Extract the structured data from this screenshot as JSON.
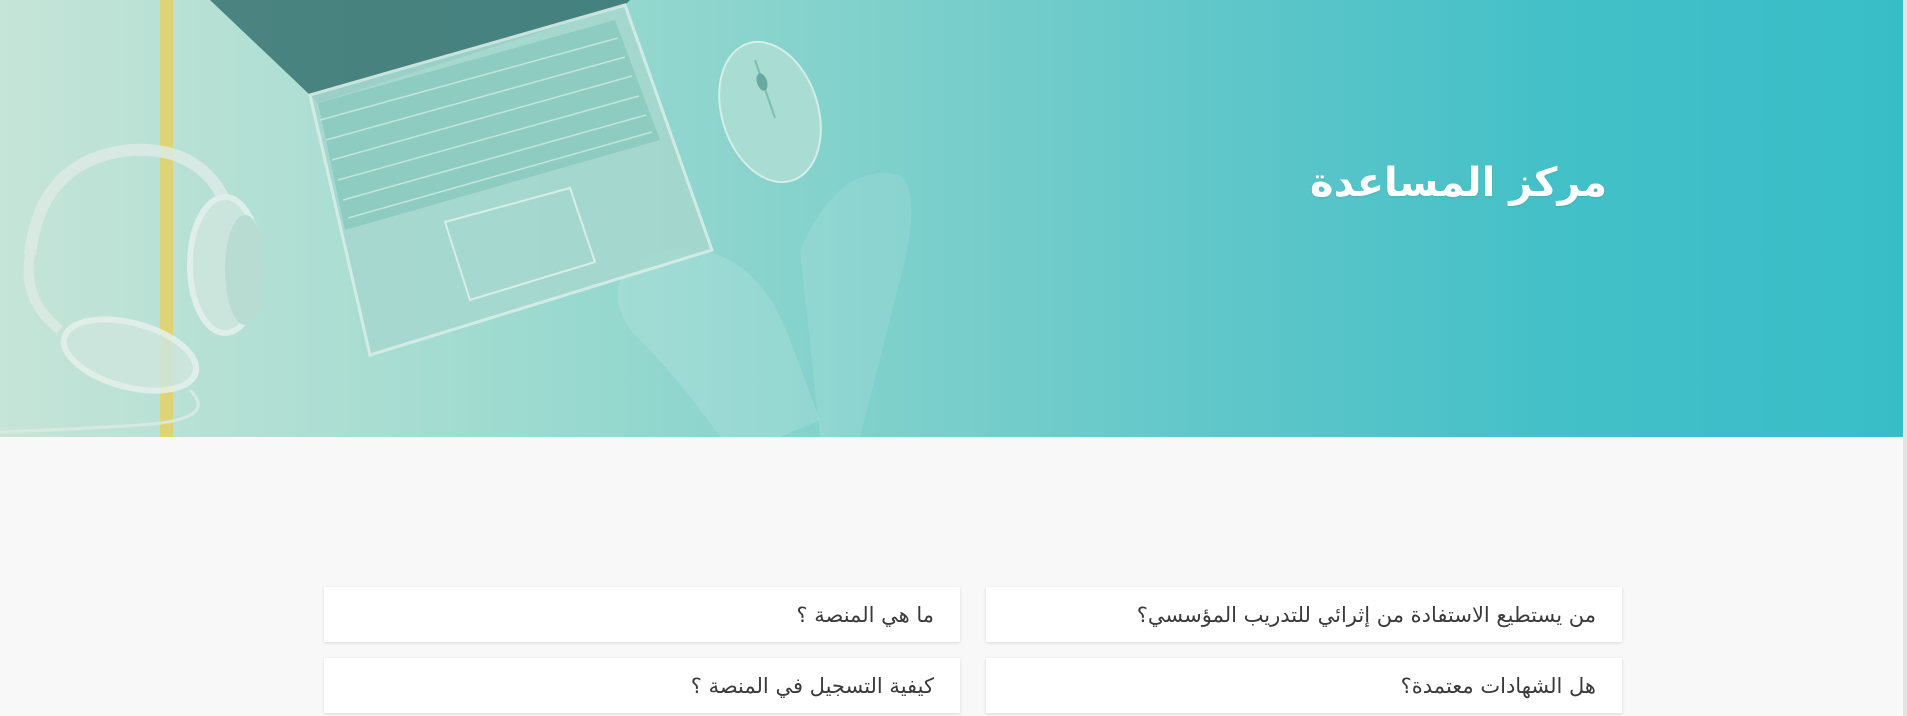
{
  "hero": {
    "title": "مركز المساعدة"
  },
  "faq": {
    "items": [
      {
        "question": "من يستطيع الاستفادة من إثرائي للتدريب المؤسسي؟"
      },
      {
        "question": "ما هي المنصة ؟"
      },
      {
        "question": "هل الشهادات معتمدة؟"
      },
      {
        "question": "كيفية التسجيل في المنصة ؟"
      }
    ]
  },
  "icons": [
    "laptop-icon",
    "headphones-icon",
    "mouse-icon"
  ],
  "colors": {
    "hero_start": "#c6e4d8",
    "hero_end": "#38bdc7",
    "accent_stripe": "#e0d36a",
    "title": "#ffffff",
    "card_bg": "#ffffff",
    "card_text": "#3a3a3a",
    "page_bg": "#f8f8f8"
  }
}
